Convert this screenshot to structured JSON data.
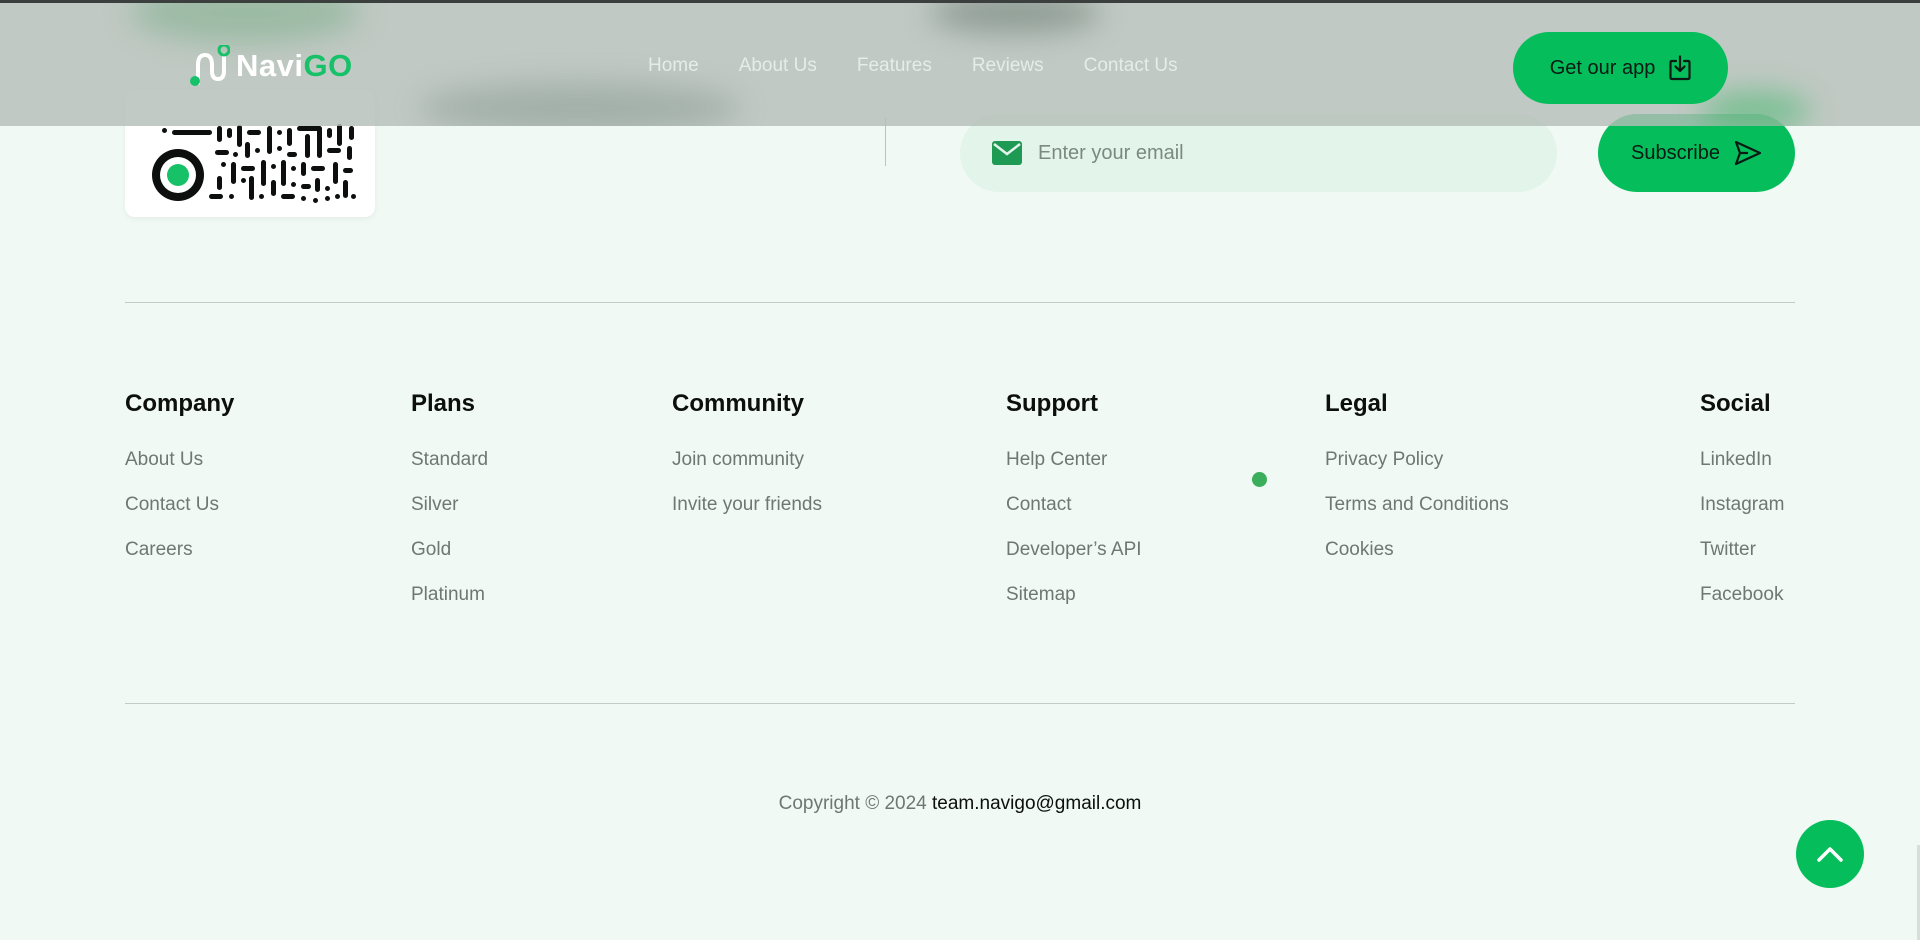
{
  "header": {
    "brand_part1": "Navi",
    "brand_part2": "GO",
    "nav": [
      "Home",
      "About Us",
      "Features",
      "Reviews",
      "Contact Us"
    ],
    "app_button": "Get our app"
  },
  "newsletter": {
    "email_placeholder": "Enter your email",
    "subscribe_label": "Subscribe"
  },
  "footer": {
    "columns": [
      {
        "title": "Company",
        "links": [
          "About Us",
          "Contact Us",
          "Careers"
        ]
      },
      {
        "title": "Plans",
        "links": [
          "Standard",
          "Silver",
          "Gold",
          "Platinum"
        ]
      },
      {
        "title": "Community",
        "links": [
          "Join community",
          "Invite your friends"
        ]
      },
      {
        "title": "Support",
        "links": [
          "Help Center",
          "Contact",
          "Developer’s API",
          "Sitemap"
        ]
      },
      {
        "title": "Legal",
        "links": [
          "Privacy Policy",
          "Terms and Conditions",
          "Cookies"
        ]
      },
      {
        "title": "Social",
        "links": [
          "LinkedIn",
          "Instagram",
          "Twitter",
          "Facebook"
        ]
      }
    ],
    "copyright_prefix": "Copyright © 2024",
    "copyright_email": "team.navigo@gmail.com"
  },
  "colors": {
    "accent": "#06bd5c",
    "background": "#f0f9f4",
    "header_overlay": "#b4beb8"
  },
  "icons": {
    "mail": "mail-icon",
    "send": "send-icon",
    "download": "download-icon",
    "scroll_top": "chevron-up-icon",
    "qr": "qr-code"
  }
}
